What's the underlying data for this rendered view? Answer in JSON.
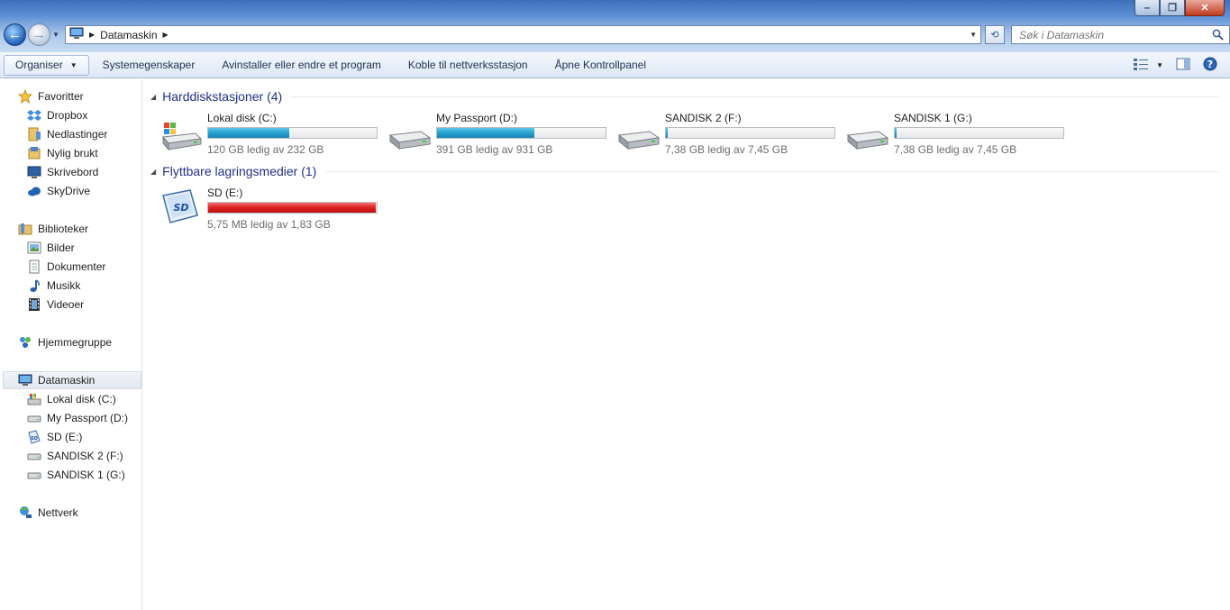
{
  "window": {
    "breadcrumb": "Datamaskin",
    "search_placeholder": "Søk i Datamaskin"
  },
  "toolbar": {
    "organise": "Organiser",
    "items": [
      "Systemegenskaper",
      "Avinstaller eller endre et program",
      "Koble til nettverksstasjon",
      "Åpne Kontrollpanel"
    ]
  },
  "sidebar": {
    "favorites": {
      "label": "Favoritter",
      "items": [
        "Dropbox",
        "Nedlastinger",
        "Nylig brukt",
        "Skrivebord",
        "SkyDrive"
      ]
    },
    "libraries": {
      "label": "Biblioteker",
      "items": [
        "Bilder",
        "Dokumenter",
        "Musikk",
        "Videoer"
      ]
    },
    "homegroup": "Hjemmegruppe",
    "computer": {
      "label": "Datamaskin",
      "items": [
        "Lokal disk (C:)",
        "My Passport (D:)",
        "SD (E:)",
        "SANDISK 2 (F:)",
        "SANDISK 1 (G:)"
      ]
    },
    "network": "Nettverk"
  },
  "main": {
    "hard_drives": {
      "title": "Harddiskstasjoner (4)",
      "drives": [
        {
          "name": "Lokal disk (C:)",
          "free": "120 GB ledig av 232 GB",
          "used_fraction": 0.48
        },
        {
          "name": "My Passport (D:)",
          "free": "391 GB ledig av 931 GB",
          "used_fraction": 0.58
        },
        {
          "name": "SANDISK 2 (F:)",
          "free": "7,38 GB ledig av 7,45 GB",
          "used_fraction": 0.01
        },
        {
          "name": "SANDISK 1 (G:)",
          "free": "7,38 GB ledig av 7,45 GB",
          "used_fraction": 0.01
        }
      ]
    },
    "removable": {
      "title": "Flyttbare lagringsmedier (1)",
      "drives": [
        {
          "name": "SD (E:)",
          "free": "5,75 MB ledig av 1,83 GB",
          "used_fraction": 0.997
        }
      ]
    }
  },
  "colors": {
    "bar_normal": "#28a5d3",
    "bar_full": "#e12424",
    "group_title": "#1e3287"
  }
}
